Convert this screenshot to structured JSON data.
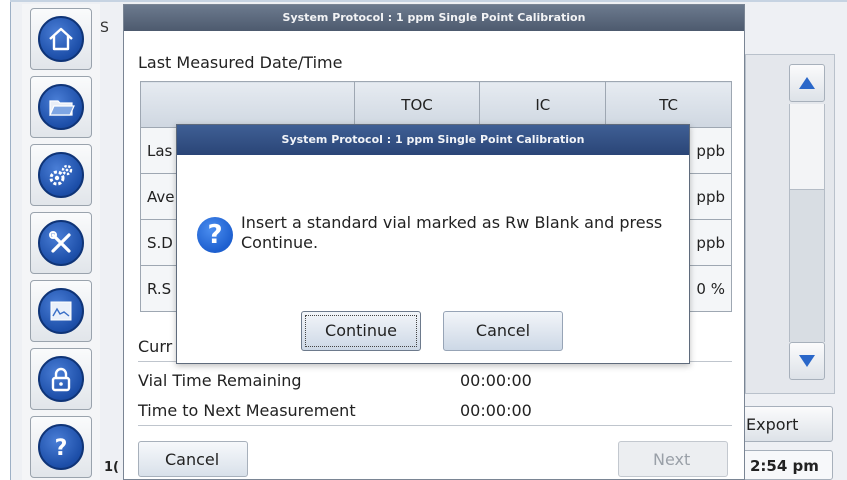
{
  "background": {
    "header_fragment": "S",
    "date_fragment": "1(",
    "export_label": "Export",
    "time": "2:54 pm"
  },
  "sidebar": {
    "items": [
      {
        "icon": "home-icon"
      },
      {
        "icon": "folder-icon"
      },
      {
        "icon": "gears-icon"
      },
      {
        "icon": "tools-icon"
      },
      {
        "icon": "chart-icon"
      },
      {
        "icon": "lock-icon"
      },
      {
        "icon": "help-icon"
      }
    ]
  },
  "calibration": {
    "title": "System Protocol : 1 ppm Single Point Calibration",
    "last_measured_label": "Last Measured Date/Time",
    "table": {
      "columns": [
        "",
        "TOC",
        "IC",
        "TC"
      ],
      "rows": [
        {
          "label": "Las",
          "tc": "ppb"
        },
        {
          "label": "Ave",
          "tc": "ppb"
        },
        {
          "label": "S.D",
          "tc": "ppb"
        },
        {
          "label": "R.S",
          "tc": "0 %"
        }
      ]
    },
    "current_label": "Curr",
    "vial_time_label": "Vial Time Remaining",
    "vial_time_value": "00:00:00",
    "next_measure_label": "Time to Next Measurement",
    "next_measure_value": "00:00:00",
    "cancel_label": "Cancel",
    "next_label": "Next"
  },
  "dialog": {
    "title": "System Protocol : 1 ppm Single Point Calibration",
    "message": "Insert a standard vial marked as Rw Blank and press Continue.",
    "continue_label": "Continue",
    "cancel_label": "Cancel"
  },
  "colors": {
    "nav_blue": "#1c4ea8",
    "dialog_title": "#2a4577",
    "window_title": "#4d5a6e"
  }
}
